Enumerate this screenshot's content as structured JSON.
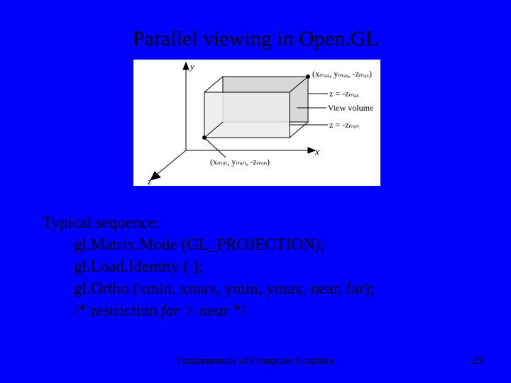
{
  "title": "Parallel viewing in Open.GL",
  "diagram": {
    "axis_y": "y",
    "axis_x": "x",
    "axis_z": "z",
    "label_tr": "(xₘₐₓ, yₘₐₓ, -zₘₐₓ)",
    "label_zmax": "z = -zₘₐₓ",
    "label_view": "View volume",
    "label_zmin": "z = -zₘᵢₙ",
    "label_br": "(xₘᵢₙ, yₘᵢₙ, -zₘᵢₙ)"
  },
  "body": {
    "heading": "Typical sequence:",
    "line1": "gl.Matrix.Mode (GL_PROJECTION);",
    "line2": "gl.Load.Identity ( );",
    "line3": "gl.Ortho (xmin, xmax, ymin, ymax, near, far);",
    "line4_a": "/* restriction ",
    "line4_b": "far > near",
    "line4_c": " */"
  },
  "footer": {
    "center": "Fundamentals of Computer Graphics",
    "page": "23"
  }
}
